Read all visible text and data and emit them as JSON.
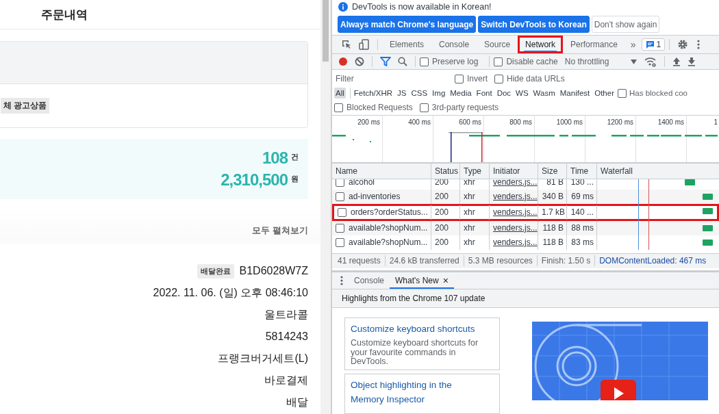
{
  "page": {
    "title": "주문내역",
    "ad_chip": "체 광고상품",
    "summary": [
      {
        "value": "108",
        "unit": "건"
      },
      {
        "value": "2,310,500",
        "unit": "원"
      }
    ],
    "expand_all": "모두 펼쳐보기",
    "order": {
      "status_badge": "배달완료",
      "order_number": "B1D6028W7Z",
      "fields": [
        "2022. 11. 06. (일) 오후 08:46:10",
        "울트라콜",
        "5814243",
        "프랭크버거세트(L)",
        "바로결제",
        "배달"
      ]
    }
  },
  "devtools": {
    "infobar": {
      "message": "DevTools is now available in Korean!",
      "buttons": [
        {
          "label": "Always match Chrome's language",
          "kind": "primary"
        },
        {
          "label": "Switch DevTools to Korean",
          "kind": "primary"
        },
        {
          "label": "Don't show again",
          "kind": "secondary"
        }
      ]
    },
    "tabs": [
      {
        "label": "Elements",
        "selected": false,
        "highlighted": false
      },
      {
        "label": "Console",
        "selected": false,
        "highlighted": false
      },
      {
        "label": "Source",
        "selected": false,
        "highlighted": false
      },
      {
        "label": "Network",
        "selected": true,
        "highlighted": true
      },
      {
        "label": "Performance",
        "selected": false,
        "highlighted": false
      }
    ],
    "more_tabs": "»",
    "issues_count": "1",
    "toolbar": {
      "recording": true,
      "checkboxes": [
        {
          "label": "Preserve log",
          "checked": false
        },
        {
          "label": "Disable cache",
          "checked": false
        }
      ],
      "throttling": "No throttling"
    },
    "filter": {
      "placeholder": "Filter",
      "checkboxes": [
        {
          "label": "Invert",
          "checked": false
        },
        {
          "label": "Hide data URLs",
          "checked": false
        }
      ]
    },
    "type_filters": [
      {
        "label": "All",
        "selected": true
      },
      {
        "label": "Fetch/XHR",
        "selected": false
      },
      {
        "label": "JS",
        "selected": false
      },
      {
        "label": "CSS",
        "selected": false
      },
      {
        "label": "Img",
        "selected": false
      },
      {
        "label": "Media",
        "selected": false
      },
      {
        "label": "Font",
        "selected": false
      },
      {
        "label": "Doc",
        "selected": false
      },
      {
        "label": "WS",
        "selected": false
      },
      {
        "label": "Wasm",
        "selected": false
      },
      {
        "label": "Manifest",
        "selected": false
      },
      {
        "label": "Other",
        "selected": false
      }
    ],
    "type_checkbox": {
      "label": "Has blocked coo",
      "checked": false
    },
    "more_checkboxes": [
      {
        "label": "Blocked Requests",
        "checked": false
      },
      {
        "label": "3rd-party requests",
        "checked": false
      }
    ],
    "overview": {
      "ticks": [
        "200 ms",
        "400 ms",
        "600 ms",
        "800 ms",
        "1000 ms",
        "1200 ms",
        "1400 ms",
        "1"
      ]
    },
    "table": {
      "columns": [
        "Name",
        "Status",
        "Type",
        "Initiator",
        "Size",
        "Time",
        "Waterfall"
      ],
      "rows": [
        {
          "name": "alcohol",
          "status": "200",
          "type": "xhr",
          "initiator": "venders.js...",
          "size": "81 B",
          "time": "130 ...",
          "checked": false,
          "highlighted": false
        },
        {
          "name": "ad-inventories",
          "status": "200",
          "type": "xhr",
          "initiator": "venders.js...",
          "size": "340 B",
          "time": "69 ms",
          "checked": false,
          "highlighted": false
        },
        {
          "name": "orders?orderStatus...",
          "status": "200",
          "type": "xhr",
          "initiator": "venders.js...",
          "size": "1.7 kB",
          "time": "140 ...",
          "checked": false,
          "highlighted": true
        },
        {
          "name": "available?shopNum...",
          "status": "200",
          "type": "xhr",
          "initiator": "venders.js...",
          "size": "118 B",
          "time": "88 ms",
          "checked": false,
          "highlighted": false
        },
        {
          "name": "available?shopNum...",
          "status": "200",
          "type": "xhr",
          "initiator": "venders.js...",
          "size": "118 B",
          "time": "83 ms",
          "checked": false,
          "highlighted": false
        }
      ]
    },
    "status_bar": [
      {
        "text": "41 requests",
        "kind": "plain"
      },
      {
        "text": "24.6 kB transferred",
        "kind": "plain"
      },
      {
        "text": "5.3 MB resources",
        "kind": "plain"
      },
      {
        "text": "Finish: 1.50 s",
        "kind": "plain"
      },
      {
        "text": "DOMContentLoaded: 467 ms",
        "kind": "dom"
      }
    ],
    "drawer": {
      "tabs": [
        {
          "label": "Console",
          "selected": false
        },
        {
          "label": "What's New",
          "selected": true,
          "close": "×"
        }
      ],
      "headline": "Highlights from the Chrome 107 update",
      "features": [
        {
          "title": "Customize keyboard shortcuts",
          "description": "Customize keyboard shortcuts for your favourite commands in DevTools."
        },
        {
          "title": "Object highlighting in the Memory Inspector"
        }
      ]
    }
  }
}
